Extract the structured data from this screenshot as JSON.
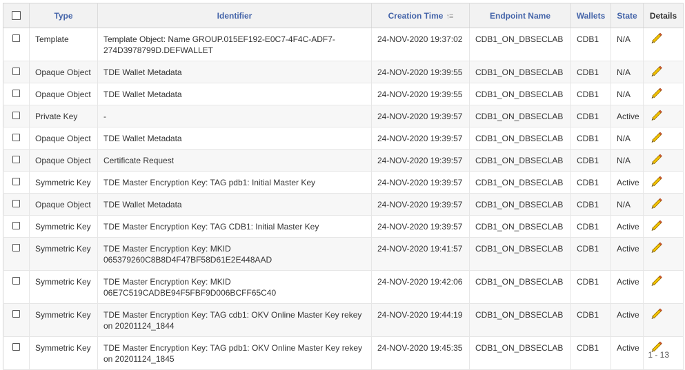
{
  "table": {
    "headers": {
      "type": "Type",
      "identifier": "Identifier",
      "creation_time": "Creation Time",
      "endpoint_name": "Endpoint Name",
      "wallets": "Wallets",
      "state": "State",
      "details": "Details"
    },
    "sort": {
      "column": "creation_time",
      "direction": "ascending",
      "icon": "sort-ascending-icon"
    },
    "rows": [
      {
        "type": "Template",
        "identifier": "Template Object: Name GROUP.015EF192-E0C7-4F4C-ADF7-274D3978799D.DEFWALLET",
        "creation_time": "24-NOV-2020 19:37:02",
        "endpoint_name": "CDB1_ON_DBSECLAB",
        "wallets": "CDB1",
        "state": "N/A"
      },
      {
        "type": "Opaque Object",
        "identifier": "TDE Wallet Metadata",
        "creation_time": "24-NOV-2020 19:39:55",
        "endpoint_name": "CDB1_ON_DBSECLAB",
        "wallets": "CDB1",
        "state": "N/A"
      },
      {
        "type": "Opaque Object",
        "identifier": "TDE Wallet Metadata",
        "creation_time": "24-NOV-2020 19:39:55",
        "endpoint_name": "CDB1_ON_DBSECLAB",
        "wallets": "CDB1",
        "state": "N/A"
      },
      {
        "type": "Private Key",
        "identifier": "-",
        "creation_time": "24-NOV-2020 19:39:57",
        "endpoint_name": "CDB1_ON_DBSECLAB",
        "wallets": "CDB1",
        "state": "Active"
      },
      {
        "type": "Opaque Object",
        "identifier": "TDE Wallet Metadata",
        "creation_time": "24-NOV-2020 19:39:57",
        "endpoint_name": "CDB1_ON_DBSECLAB",
        "wallets": "CDB1",
        "state": "N/A"
      },
      {
        "type": "Opaque Object",
        "identifier": "Certificate Request",
        "creation_time": "24-NOV-2020 19:39:57",
        "endpoint_name": "CDB1_ON_DBSECLAB",
        "wallets": "CDB1",
        "state": "N/A"
      },
      {
        "type": "Symmetric Key",
        "identifier": "TDE Master Encryption Key: TAG pdb1: Initial Master Key",
        "creation_time": "24-NOV-2020 19:39:57",
        "endpoint_name": "CDB1_ON_DBSECLAB",
        "wallets": "CDB1",
        "state": "Active"
      },
      {
        "type": "Opaque Object",
        "identifier": "TDE Wallet Metadata",
        "creation_time": "24-NOV-2020 19:39:57",
        "endpoint_name": "CDB1_ON_DBSECLAB",
        "wallets": "CDB1",
        "state": "N/A"
      },
      {
        "type": "Symmetric Key",
        "identifier": "TDE Master Encryption Key: TAG CDB1: Initial Master Key",
        "creation_time": "24-NOV-2020 19:39:57",
        "endpoint_name": "CDB1_ON_DBSECLAB",
        "wallets": "CDB1",
        "state": "Active"
      },
      {
        "type": "Symmetric Key",
        "identifier": "TDE Master Encryption Key: MKID 065379260C8B8D4F47BF58D61E2E448AAD",
        "creation_time": "24-NOV-2020 19:41:57",
        "endpoint_name": "CDB1_ON_DBSECLAB",
        "wallets": "CDB1",
        "state": "Active"
      },
      {
        "type": "Symmetric Key",
        "identifier": "TDE Master Encryption Key: MKID 06E7C519CADBE94F5FBF9D006BCFF65C40",
        "creation_time": "24-NOV-2020 19:42:06",
        "endpoint_name": "CDB1_ON_DBSECLAB",
        "wallets": "CDB1",
        "state": "Active"
      },
      {
        "type": "Symmetric Key",
        "identifier": "TDE Master Encryption Key: TAG cdb1: OKV Online Master Key rekey on 20201124_1844",
        "creation_time": "24-NOV-2020 19:44:19",
        "endpoint_name": "CDB1_ON_DBSECLAB",
        "wallets": "CDB1",
        "state": "Active"
      },
      {
        "type": "Symmetric Key",
        "identifier": "TDE Master Encryption Key: TAG pdb1: OKV Online Master Key rekey on 20201124_1845",
        "creation_time": "24-NOV-2020 19:45:35",
        "endpoint_name": "CDB1_ON_DBSECLAB",
        "wallets": "CDB1",
        "state": "Active"
      }
    ],
    "details_icon": "pencil-edit-icon",
    "pagination_text": "1 - 13"
  },
  "colors": {
    "header_link": "#4464a9",
    "header_bg": "#f2f2f2",
    "row_alt_bg": "#f7f7f7",
    "pencil": "#e8b800"
  }
}
